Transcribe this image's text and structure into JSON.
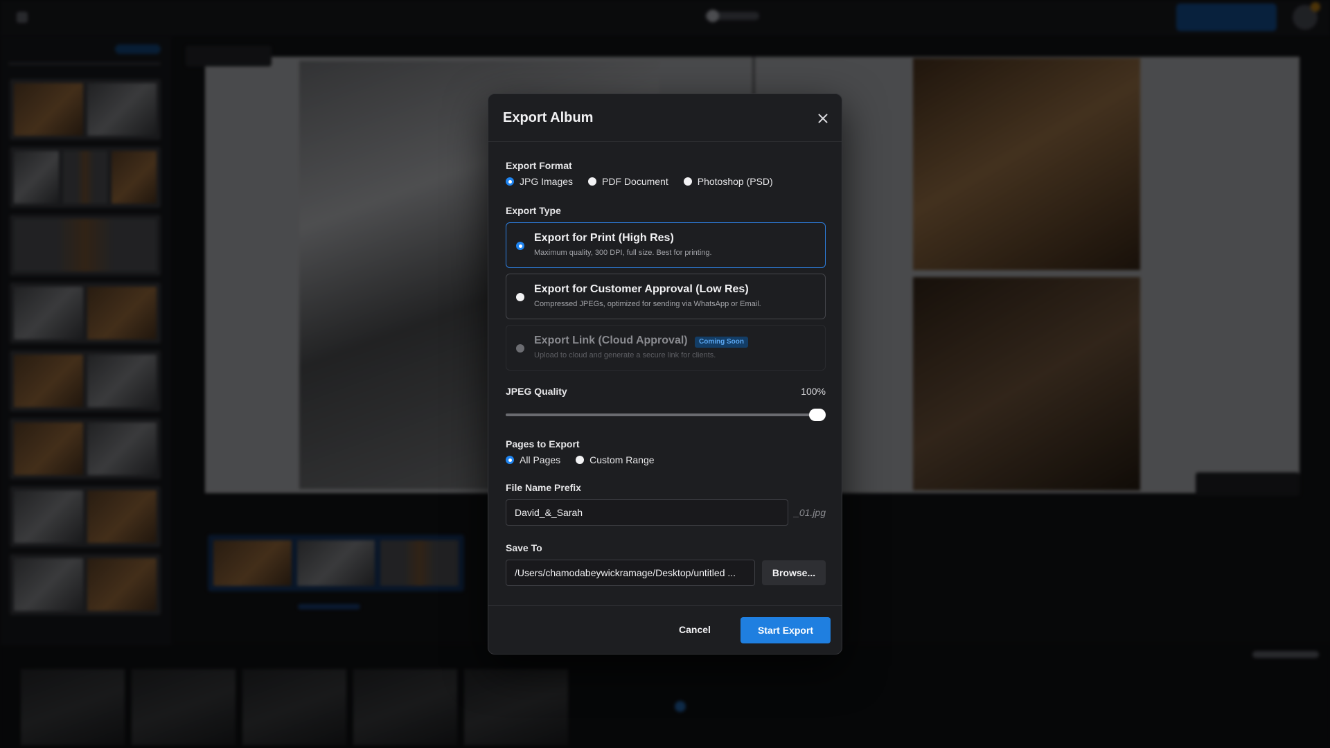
{
  "modal": {
    "title": "Export Album",
    "export_format": {
      "label": "Export Format",
      "options": [
        {
          "label": "JPG Images",
          "selected": true
        },
        {
          "label": "PDF Document",
          "selected": false
        },
        {
          "label": "Photoshop (PSD)",
          "selected": false
        }
      ]
    },
    "export_type": {
      "label": "Export Type",
      "options": [
        {
          "title": "Export for Print (High Res)",
          "description": "Maximum quality, 300 DPI, full size. Best for printing.",
          "selected": true,
          "disabled": false
        },
        {
          "title": "Export for Customer Approval (Low Res)",
          "description": "Compressed JPEGs, optimized for sending via WhatsApp or Email.",
          "selected": false,
          "disabled": false
        },
        {
          "title": "Export Link (Cloud Approval)",
          "description": "Upload to cloud and generate a secure link for clients.",
          "selected": false,
          "disabled": true,
          "badge": "Coming Soon"
        }
      ]
    },
    "jpeg_quality": {
      "label": "JPEG Quality",
      "value_text": "100%",
      "value": 100
    },
    "pages_to_export": {
      "label": "Pages to Export",
      "options": [
        {
          "label": "All Pages",
          "selected": true
        },
        {
          "label": "Custom Range",
          "selected": false
        }
      ]
    },
    "file_name_prefix": {
      "label": "File Name Prefix",
      "value": "David_&_Sarah",
      "suffix": "_01.jpg"
    },
    "save_to": {
      "label": "Save To",
      "value": "/Users/chamodabeywickramage/Desktop/untitled ...",
      "browse_label": "Browse..."
    },
    "footer": {
      "cancel_label": "Cancel",
      "start_label": "Start Export"
    }
  },
  "colors": {
    "accent": "#1f7fe0",
    "modal_bg": "#1d1e21",
    "app_bg": "#0e0f11"
  }
}
